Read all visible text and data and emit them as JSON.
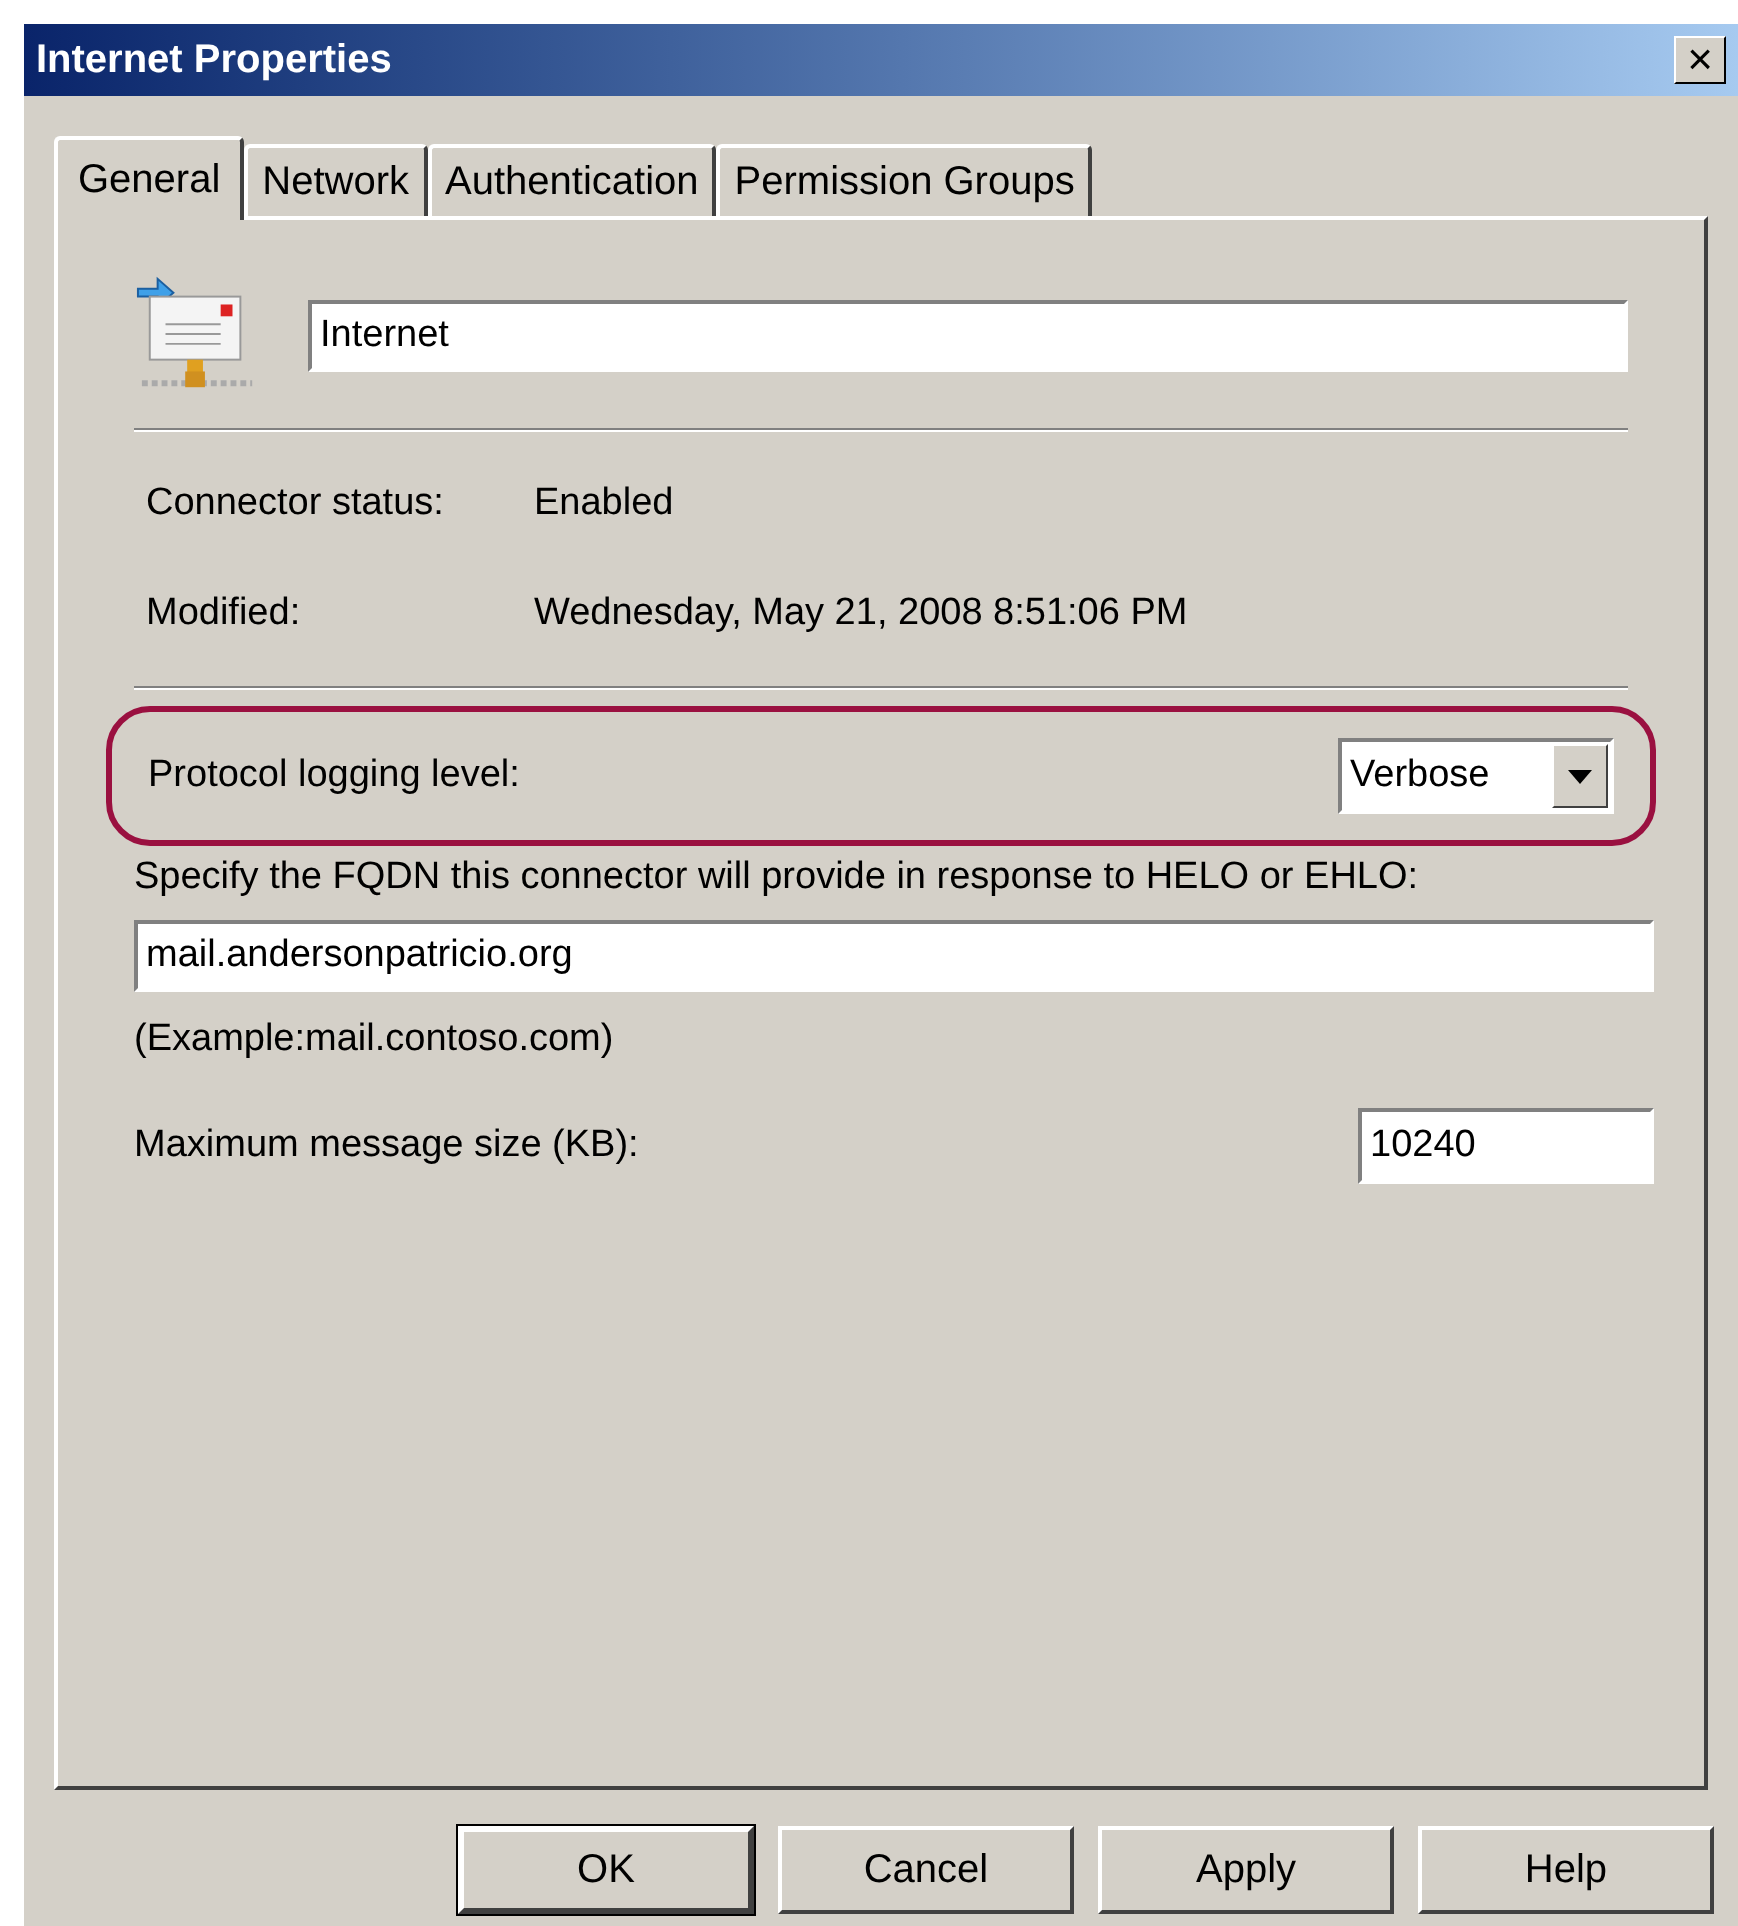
{
  "window": {
    "title": "Internet Properties",
    "close": "×"
  },
  "tabs": [
    {
      "label": "General",
      "selected": true
    },
    {
      "label": "Network",
      "selected": false
    },
    {
      "label": "Authentication",
      "selected": false
    },
    {
      "label": "Permission Groups",
      "selected": false
    }
  ],
  "name_field": {
    "value": "Internet"
  },
  "info": [
    {
      "label": "Connector status:",
      "value": "Enabled"
    },
    {
      "label": "Modified:",
      "value": "Wednesday, May 21, 2008 8:51:06 PM"
    }
  ],
  "logging": {
    "label": "Protocol logging level:",
    "value": "Verbose",
    "highlighted": true
  },
  "fqdn": {
    "label": "Specify the FQDN this connector will provide in response to HELO or EHLO:",
    "value": "mail.andersonpatricio.org",
    "example": "(Example:mail.contoso.com)"
  },
  "max_size": {
    "label": "Maximum message size (KB):",
    "value": "10240"
  },
  "buttons": [
    {
      "label": "OK",
      "default": true
    },
    {
      "label": "Cancel",
      "default": false
    },
    {
      "label": "Apply",
      "default": false
    },
    {
      "label": "Help",
      "default": false
    }
  ]
}
